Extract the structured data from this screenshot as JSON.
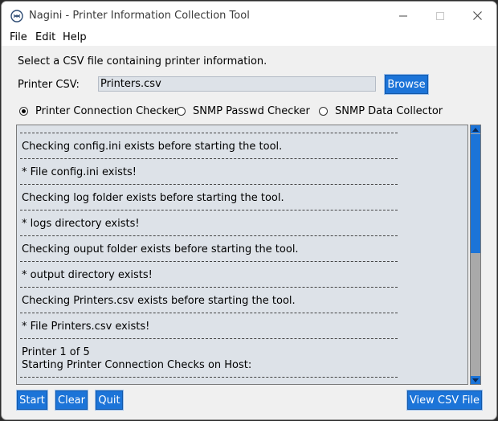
{
  "window": {
    "title": "Nagini - Printer Information Collection Tool",
    "accent_color": "#1c74d8"
  },
  "menu": {
    "file": "File",
    "edit": "Edit",
    "help": "Help"
  },
  "form": {
    "instructions": "Select a CSV file containing printer information.",
    "csv_label": "Printer CSV:",
    "csv_value": "Printers.csv",
    "browse_label": "Browse"
  },
  "modes": [
    {
      "label": "Printer Connection Checker",
      "selected": true
    },
    {
      "label": "SNMP Passwd Checker",
      "selected": false
    },
    {
      "label": "SNMP Data Collector",
      "selected": false
    }
  ],
  "log": {
    "lines": [
      "Checking config.ini exists before starting the tool.",
      "* File config.ini exists!",
      "Checking log folder exists before starting the tool.",
      "* logs directory exists!",
      "Checking ouput folder exists before starting the tool.",
      "* output directory exists!",
      "Checking Printers.csv exists before starting the tool.",
      "* File Printers.csv exists!",
      "Printer 1 of 5",
      "Starting Printer Connection Checks on Host:"
    ]
  },
  "buttons": {
    "start": "Start",
    "clear": "Clear",
    "quit": "Quit",
    "view_csv": "View CSV File"
  }
}
